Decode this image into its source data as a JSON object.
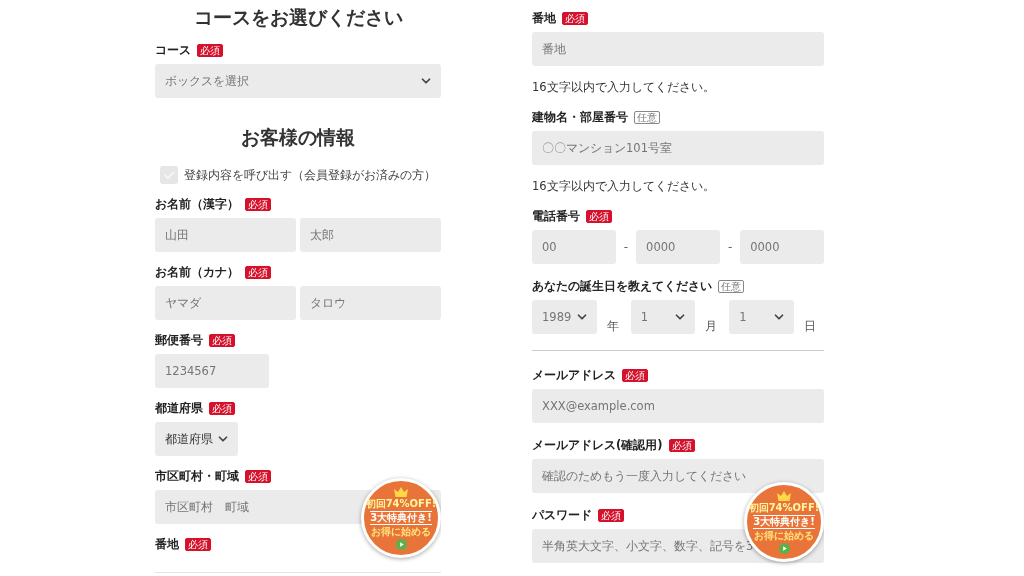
{
  "columns": [
    {
      "items": [
        {
          "kind": "heading",
          "text": "コースをお選びください"
        },
        {
          "kind": "field",
          "label": "コース",
          "badge": {
            "text": "必須",
            "required": true
          },
          "controls": [
            {
              "kind": "select",
              "placeholder": "ボックスを選択"
            }
          ]
        },
        {
          "kind": "heading",
          "text": "お客様の情報"
        },
        {
          "kind": "checkbox",
          "text": "登録内容を呼び出す（会員登録がお済みの方）",
          "checked": false
        },
        {
          "kind": "field",
          "label": "お名前（漢字）",
          "badge": {
            "text": "必須",
            "required": true
          },
          "controls": [
            {
              "kind": "input",
              "placeholder": "山田"
            },
            {
              "kind": "input",
              "placeholder": "太郎"
            }
          ]
        },
        {
          "kind": "field",
          "label": "お名前（カナ）",
          "badge": {
            "text": "必須",
            "required": true
          },
          "controls": [
            {
              "kind": "input",
              "placeholder": "ヤマダ"
            },
            {
              "kind": "input",
              "placeholder": "タロウ"
            }
          ]
        },
        {
          "kind": "field",
          "label": "郵便番号",
          "badge": {
            "text": "必須",
            "required": true
          },
          "controls": [
            {
              "kind": "short-input",
              "placeholder": "1234567"
            }
          ]
        },
        {
          "kind": "field",
          "label": "都道府県",
          "badge": {
            "text": "必須",
            "required": true
          },
          "controls": [
            {
              "kind": "short-select",
              "value": "都道府県"
            }
          ]
        },
        {
          "kind": "field",
          "label": "市区町村・町域",
          "badge": {
            "text": "必須",
            "required": true
          },
          "controls": [
            {
              "kind": "input",
              "placeholder": "市区町村　町域"
            }
          ]
        },
        {
          "kind": "field",
          "label": "番地",
          "badge": {
            "text": "必須",
            "required": true
          }
        }
      ],
      "promo": {
        "lines": [
          "初回74%OFF!",
          "3大特典付き!",
          "お得に始める"
        ]
      }
    },
    {
      "items": [
        {
          "kind": "field",
          "label": "番地",
          "badge": {
            "text": "必須",
            "required": true
          },
          "controls": [
            {
              "kind": "input",
              "placeholder": "番地"
            }
          ],
          "note": "16文字以内で入力してください。"
        },
        {
          "kind": "field",
          "label": "建物名・部屋番号",
          "badge": {
            "text": "任意",
            "required": false
          },
          "controls": [
            {
              "kind": "input",
              "placeholder": "〇〇マンション101号室"
            }
          ],
          "note": "16文字以内で入力してください。"
        },
        {
          "kind": "field",
          "label": "電話番号",
          "badge": {
            "text": "必須",
            "required": true
          },
          "controls": [
            {
              "kind": "input",
              "placeholder": "00"
            },
            {
              "kind": "text",
              "text": "-"
            },
            {
              "kind": "input",
              "placeholder": "0000"
            },
            {
              "kind": "text",
              "text": "-"
            },
            {
              "kind": "input",
              "placeholder": "0000"
            }
          ]
        },
        {
          "kind": "field",
          "label": "あなたの誕生日を教えてください",
          "badge": {
            "text": "任意",
            "required": false
          },
          "controls": [
            {
              "kind": "date-select",
              "placeholder": "1989"
            },
            {
              "kind": "suffix",
              "text": "年"
            },
            {
              "kind": "date-select",
              "placeholder": "1"
            },
            {
              "kind": "suffix",
              "text": "月"
            },
            {
              "kind": "date-select",
              "placeholder": "1"
            },
            {
              "kind": "suffix",
              "text": "日"
            }
          ]
        },
        {
          "kind": "divider"
        },
        {
          "kind": "field",
          "label": "メールアドレス",
          "badge": {
            "text": "必須",
            "required": true
          },
          "controls": [
            {
              "kind": "input",
              "placeholder": "XXX@example.com"
            }
          ]
        },
        {
          "kind": "field",
          "label": "メールアドレス(確認用)",
          "badge": {
            "text": "必須",
            "required": true
          },
          "controls": [
            {
              "kind": "input",
              "placeholder": "確認のためもう一度入力してください"
            }
          ]
        },
        {
          "kind": "field",
          "label": "パスワード",
          "badge": {
            "text": "必須",
            "required": true
          },
          "controls": [
            {
              "kind": "input",
              "placeholder": "半角英大文字、小文字、数字、記号を3"
            }
          ]
        }
      ],
      "promo": {
        "lines": [
          "初回74%OFF!",
          "3大特典付き!",
          "お得に始める"
        ]
      }
    }
  ]
}
